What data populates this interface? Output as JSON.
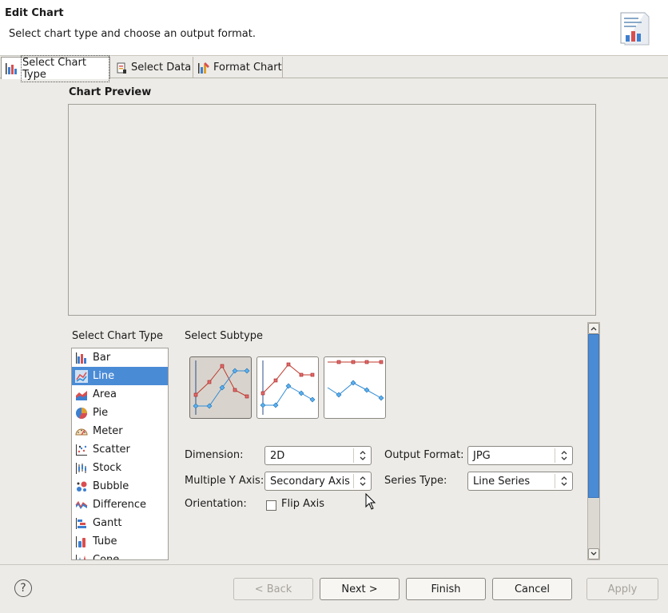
{
  "dialog": {
    "title": "Edit Chart",
    "subtitle": "Select chart type and choose an output format."
  },
  "tabs": [
    {
      "label": "Select Chart Type",
      "icon": "chart-type-icon",
      "active": true
    },
    {
      "label": "Select Data",
      "icon": "select-data-icon",
      "active": false
    },
    {
      "label": "Format Chart",
      "icon": "format-chart-icon",
      "active": false
    }
  ],
  "preview": {
    "title": "Chart Preview"
  },
  "chart_type": {
    "label": "Select Chart Type",
    "selected": "Line",
    "items": [
      {
        "label": "Bar",
        "icon": "bar-chart-icon"
      },
      {
        "label": "Line",
        "icon": "line-chart-icon"
      },
      {
        "label": "Area",
        "icon": "area-chart-icon"
      },
      {
        "label": "Pie",
        "icon": "pie-chart-icon"
      },
      {
        "label": "Meter",
        "icon": "meter-chart-icon"
      },
      {
        "label": "Scatter",
        "icon": "scatter-chart-icon"
      },
      {
        "label": "Stock",
        "icon": "stock-chart-icon"
      },
      {
        "label": "Bubble",
        "icon": "bubble-chart-icon"
      },
      {
        "label": "Difference",
        "icon": "difference-chart-icon"
      },
      {
        "label": "Gantt",
        "icon": "gantt-chart-icon"
      },
      {
        "label": "Tube",
        "icon": "tube-chart-icon"
      },
      {
        "label": "Cone",
        "icon": "cone-chart-icon"
      }
    ]
  },
  "subtype": {
    "label": "Select Subtype",
    "options": [
      "line-subtype-overlay",
      "line-subtype-stacked",
      "line-subtype-percent"
    ],
    "selected_index": 0
  },
  "form": {
    "dimension_label": "Dimension:",
    "dimension_value": "2D",
    "output_format_label": "Output Format:",
    "output_format_value": "JPG",
    "multiple_y_axis_label": "Multiple Y Axis:",
    "multiple_y_axis_value": "Secondary Axis",
    "series_type_label": "Series Type:",
    "series_type_value": "Line Series",
    "orientation_label": "Orientation:",
    "flip_axis_label": "Flip Axis",
    "flip_axis_checked": false
  },
  "buttons": {
    "help": "?",
    "back": "< Back",
    "next": "Next >",
    "finish": "Finish",
    "cancel": "Cancel",
    "apply": "Apply"
  },
  "colors": {
    "selection": "#4a8bd6",
    "series_red": "#c0392b",
    "series_blue": "#2e8bd6"
  }
}
